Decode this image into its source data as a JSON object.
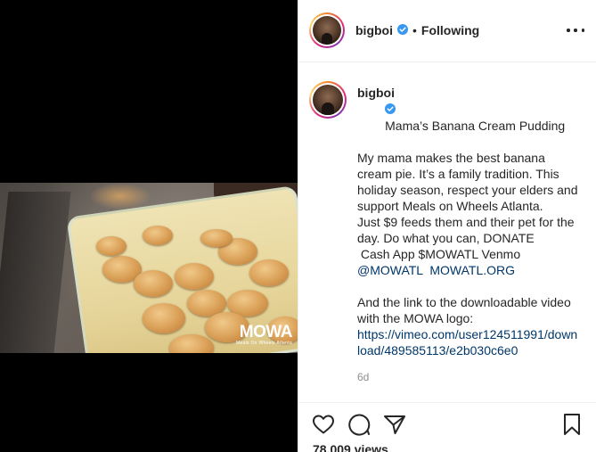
{
  "post": {
    "username": "bigboi",
    "follow_separator": "•",
    "follow_status": "Following",
    "caption_title": "Mama’s Banana Cream Pudding",
    "caption_body": "My mama makes the best banana cream pie. It’s a family tradition. This holiday season, respect your elders and support Meals on Wheels Atlanta.\nJust $9 feeds them and their pet for the day. Do what you can, DONATE\n Cash App $MOWATL Venmo",
    "caption_link_handle": "@MOWATL",
    "caption_link_site": "MOWATL.ORG",
    "caption_body_2": "And the link to the downloadable video with the MOWA logo:",
    "caption_link_url": "https://vimeo.com/user124511991/download/489585113/e2b030c6e0",
    "timestamp": "6d",
    "views": "78,009 views"
  },
  "video": {
    "watermark_logo": "MOWA",
    "watermark_sub": "Meals On Wheels Atlanta"
  },
  "icons": {
    "more": "more-options-icon",
    "verified": "verified-badge-icon",
    "like": "heart-icon",
    "comment": "comment-bubble-icon",
    "share": "paper-plane-icon",
    "save": "bookmark-icon"
  },
  "colors": {
    "link": "#00376b",
    "verified": "#3897f0",
    "muted": "#8e8e8e",
    "text": "#262626"
  }
}
